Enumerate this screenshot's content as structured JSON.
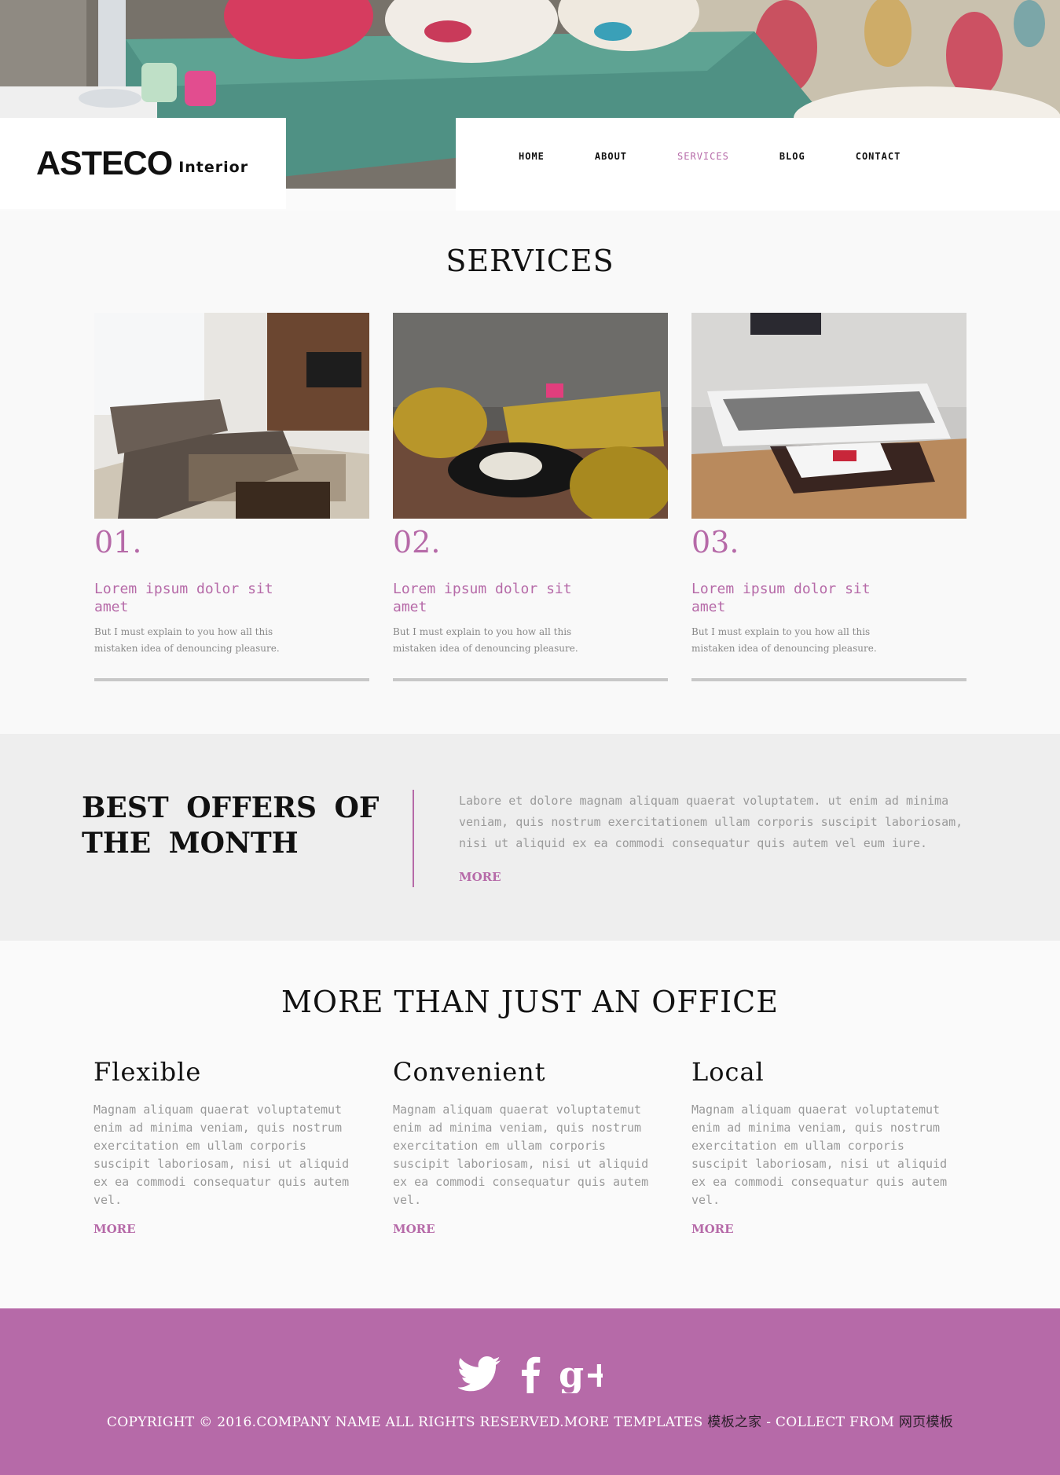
{
  "brand": {
    "name": "ASTECO",
    "sub": "Interior"
  },
  "nav": {
    "items": [
      {
        "label": "HOME"
      },
      {
        "label": "ABOUT"
      },
      {
        "label": "SERVICES"
      },
      {
        "label": "BLOG"
      },
      {
        "label": "CONTACT"
      }
    ],
    "active": "SERVICES"
  },
  "services": {
    "title": "SERVICES",
    "cards": [
      {
        "num": "01.",
        "heading": "Lorem ipsum dolor sit amet",
        "text": "But I must explain to you how all this mistaken idea of denouncing pleasure."
      },
      {
        "num": "02.",
        "heading": "Lorem ipsum dolor sit amet",
        "text": "But I must explain to you how all this mistaken idea of denouncing pleasure."
      },
      {
        "num": "03.",
        "heading": "Lorem ipsum dolor sit amet",
        "text": "But I must explain to you how all this mistaken idea of denouncing pleasure."
      }
    ]
  },
  "offers": {
    "title": "BEST OFFERS OF THE MONTH",
    "text": "Labore et dolore magnam aliquam quaerat voluptatem. ut enim ad minima veniam, quis nostrum exercitationem ullam corporis suscipit laboriosam, nisi ut aliquid ex ea commodi consequatur quis autem vel eum iure.",
    "more": "MORE"
  },
  "office": {
    "title": "MORE THAN JUST AN OFFICE",
    "features": [
      {
        "heading": "Flexible",
        "text": "Magnam aliquam quaerat voluptatemut enim ad minima veniam, quis nostrum exercitation em ullam corporis suscipit laboriosam, nisi ut aliquid ex ea commodi consequatur quis autem vel.",
        "more": "MORE"
      },
      {
        "heading": "Convenient",
        "text": "Magnam aliquam quaerat voluptatemut enim ad minima veniam, quis nostrum exercitation em ullam corporis suscipit laboriosam, nisi ut aliquid ex ea commodi consequatur quis autem vel.",
        "more": "MORE"
      },
      {
        "heading": "Local",
        "text": "Magnam aliquam quaerat voluptatemut enim ad minima veniam, quis nostrum exercitation em ullam corporis suscipit laboriosam, nisi ut aliquid ex ea commodi consequatur quis autem vel.",
        "more": "MORE"
      }
    ]
  },
  "footer": {
    "social": [
      "twitter-icon",
      "facebook-icon",
      "google-plus-icon"
    ],
    "copyright_text": "COPYRIGHT © 2016.COMPANY NAME ALL RIGHTS RESERVED.MORE TEMPLATES ",
    "copyright_cn1": "模板之家",
    "copyright_mid": " - COLLECT FROM ",
    "copyright_cn2": "网页模板"
  },
  "colors": {
    "accent": "#b66aa8",
    "footer_bg": "#b66aa8",
    "offers_bg": "#eeeeee"
  }
}
